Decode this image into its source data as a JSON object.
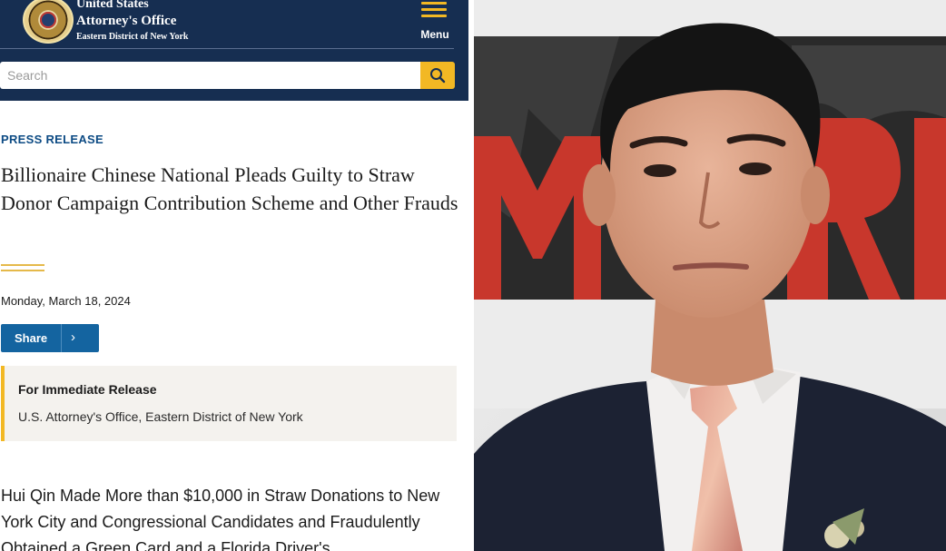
{
  "header": {
    "office_line1": "United States",
    "office_line2": "Attorney's Office",
    "office_line3": "Eastern District of New York",
    "menu_label": "Menu"
  },
  "search": {
    "placeholder": "Search"
  },
  "article": {
    "eyebrow": "PRESS RELEASE",
    "headline": "Billionaire Chinese National Pleads Guilty to Straw Donor Campaign Contribution Scheme and Other Frauds",
    "date": "Monday, March 18, 2024",
    "share_label": "Share",
    "notice_title": "For Immediate Release",
    "notice_subtitle": "U.S. Attorney's Office, Eastern District of New York",
    "subhead": "Hui Qin Made More than $10,000 in Straw Donations to New York City and Congressional Candidates and Fraudulently Obtained a Green Card and a Florida Driver's"
  },
  "photo": {
    "backdrop_letters": "M  RI"
  },
  "colors": {
    "header_navy": "#162e51",
    "accent_gold": "#f2b824",
    "link_blue": "#1464a0",
    "eyebrow_blue": "#0d4b84",
    "notice_bg": "#f4f2ee"
  }
}
